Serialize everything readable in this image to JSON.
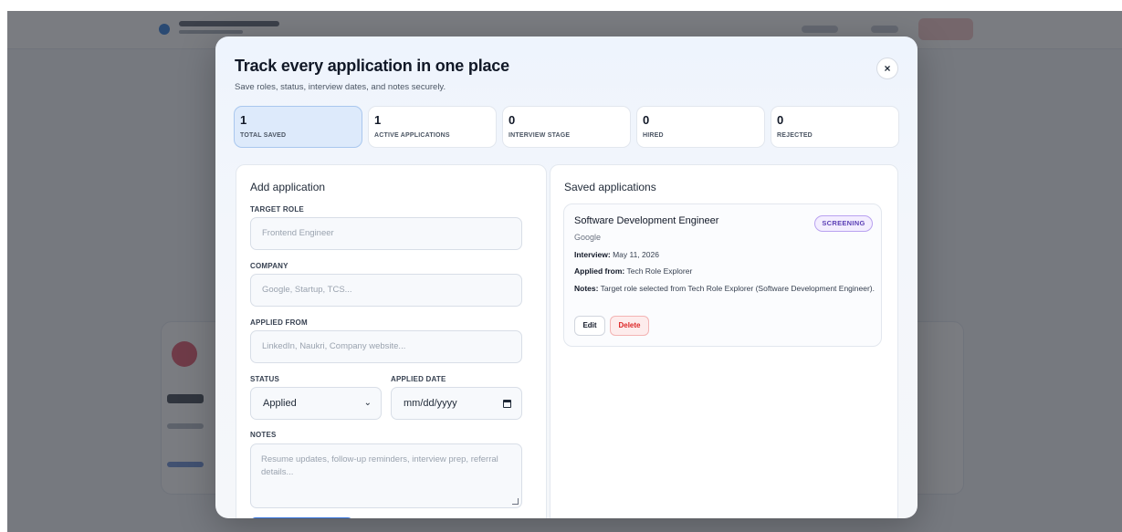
{
  "modal": {
    "title": "Track every application in one place",
    "subtitle": "Save roles, status, interview dates, and notes securely.",
    "close_label": "×"
  },
  "stats": [
    {
      "value": "1",
      "label": "TOTAL SAVED"
    },
    {
      "value": "1",
      "label": "ACTIVE APPLICATIONS"
    },
    {
      "value": "0",
      "label": "INTERVIEW STAGE"
    },
    {
      "value": "0",
      "label": "HIRED"
    },
    {
      "value": "0",
      "label": "REJECTED"
    }
  ],
  "form": {
    "title": "Add application",
    "target_role": {
      "label": "TARGET ROLE",
      "placeholder": "Frontend Engineer"
    },
    "company": {
      "label": "COMPANY",
      "placeholder": "Google, Startup, TCS..."
    },
    "applied_from": {
      "label": "APPLIED FROM",
      "placeholder": "LinkedIn, Naukri, Company website..."
    },
    "status": {
      "label": "STATUS",
      "value": "Applied"
    },
    "applied_date": {
      "label": "APPLIED DATE",
      "placeholder": "mm/dd/yyyy"
    },
    "notes": {
      "label": "NOTES",
      "placeholder": "Resume updates, follow-up reminders, interview prep, referral details..."
    }
  },
  "saved": {
    "title": "Saved applications",
    "items": [
      {
        "role": "Software Development Engineer",
        "company": "Google",
        "status": "SCREENING",
        "interview_label": "Interview:",
        "interview": "May 11, 2026",
        "applied_from_label": "Applied from:",
        "applied_from": "Tech Role Explorer",
        "notes_label": "Notes:",
        "notes": "Target role selected from Tech Role Explorer (Software Development Engineer).",
        "edit_label": "Edit",
        "delete_label": "Delete"
      }
    ]
  },
  "colors": {
    "accent": "#2f6fdc",
    "status_screening": "#5b3fb5",
    "delete": "#dc2626"
  }
}
